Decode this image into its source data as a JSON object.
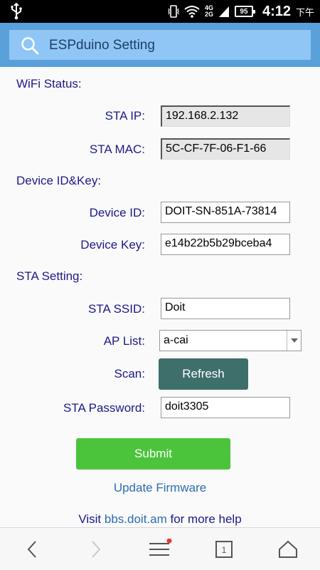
{
  "statusbar": {
    "net_top": "4G",
    "net_bottom": "2G",
    "battery": "95",
    "time": "4:12",
    "ampm": "下午"
  },
  "header": {
    "title": "ESPduino Setting"
  },
  "wifi_status": {
    "title": "WiFi Status:",
    "sta_ip_label": "STA IP:",
    "sta_ip_value": "192.168.2.132",
    "sta_mac_label": "STA MAC:",
    "sta_mac_value": "5C-CF-7F-06-F1-66"
  },
  "device": {
    "title": "Device ID&Key:",
    "id_label": "Device ID:",
    "id_value": "DOIT-SN-851A-73814",
    "key_label": "Device Key:",
    "key_value": "e14b22b5b29bceba4"
  },
  "sta_setting": {
    "title": "STA Setting:",
    "ssid_label": "STA SSID:",
    "ssid_value": "Doit",
    "ap_list_label": "AP List:",
    "ap_list_selected": "a-cai",
    "scan_label": "Scan:",
    "refresh_label": "Refresh",
    "password_label": "STA Password:",
    "password_value": "doit3305"
  },
  "actions": {
    "submit_label": "Submit",
    "update_firmware": "Update Firmware",
    "help_prefix": "Visit ",
    "help_link": "bbs.doit.am",
    "help_suffix": " for more help"
  },
  "bottom_nav": {
    "tab_count": "1",
    "badge_color": "#e53935"
  }
}
